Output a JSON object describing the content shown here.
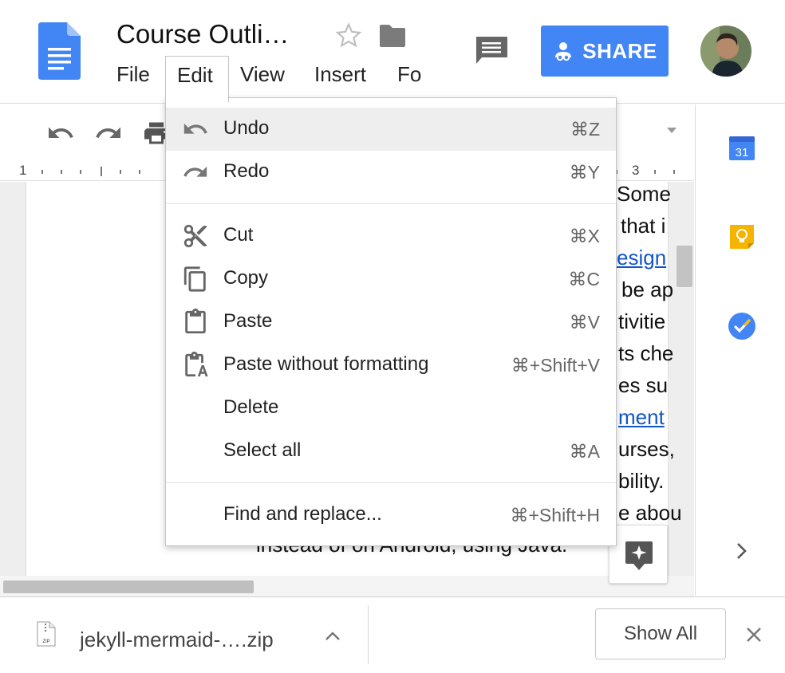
{
  "header": {
    "doc_title": "Course Outli…",
    "menus": [
      "File",
      "Edit",
      "View",
      "Insert",
      "Fo"
    ],
    "share_label": "SHARE",
    "colors": {
      "share": "#4285f4",
      "doc_icon": "#4285f4"
    }
  },
  "toolbar": {
    "icons": [
      "undo-icon",
      "redo-icon",
      "print-icon"
    ],
    "ruler_labels": [
      "1",
      "3"
    ]
  },
  "document": {
    "lines": [
      "Some",
      "that i",
      "esign",
      "be ap",
      "tivitie",
      "ts che",
      "es su",
      "ment",
      "urses,",
      "bility.",
      "e abou",
      "instead of on Android, using Java."
    ],
    "link_lines": [
      2,
      7
    ]
  },
  "edit_menu": {
    "groups": [
      [
        {
          "icon": "undo-icon",
          "label": "Undo",
          "shortcut": "⌘Z"
        },
        {
          "icon": "redo-icon",
          "label": "Redo",
          "shortcut": "⌘Y"
        }
      ],
      [
        {
          "icon": "cut-icon",
          "label": "Cut",
          "shortcut": "⌘X"
        },
        {
          "icon": "copy-icon",
          "label": "Copy",
          "shortcut": "⌘C"
        },
        {
          "icon": "paste-icon",
          "label": "Paste",
          "shortcut": "⌘V"
        },
        {
          "icon": "paste-plain-icon",
          "label": "Paste without formatting",
          "shortcut": "⌘+Shift+V"
        },
        {
          "icon": "",
          "label": "Delete",
          "shortcut": ""
        },
        {
          "icon": "",
          "label": "Select all",
          "shortcut": "⌘A"
        }
      ],
      [
        {
          "icon": "",
          "label": "Find and replace...",
          "shortcut": "⌘+Shift+H"
        }
      ]
    ]
  },
  "side_panel": {
    "calendar_day": "31",
    "icons": [
      "calendar-icon",
      "keep-icon",
      "tasks-icon",
      "chevron-right-icon"
    ]
  },
  "downloads": {
    "file_name": "jekyll-mermaid-….zip",
    "file_icon_text": "ZIP",
    "show_all_label": "Show All"
  }
}
